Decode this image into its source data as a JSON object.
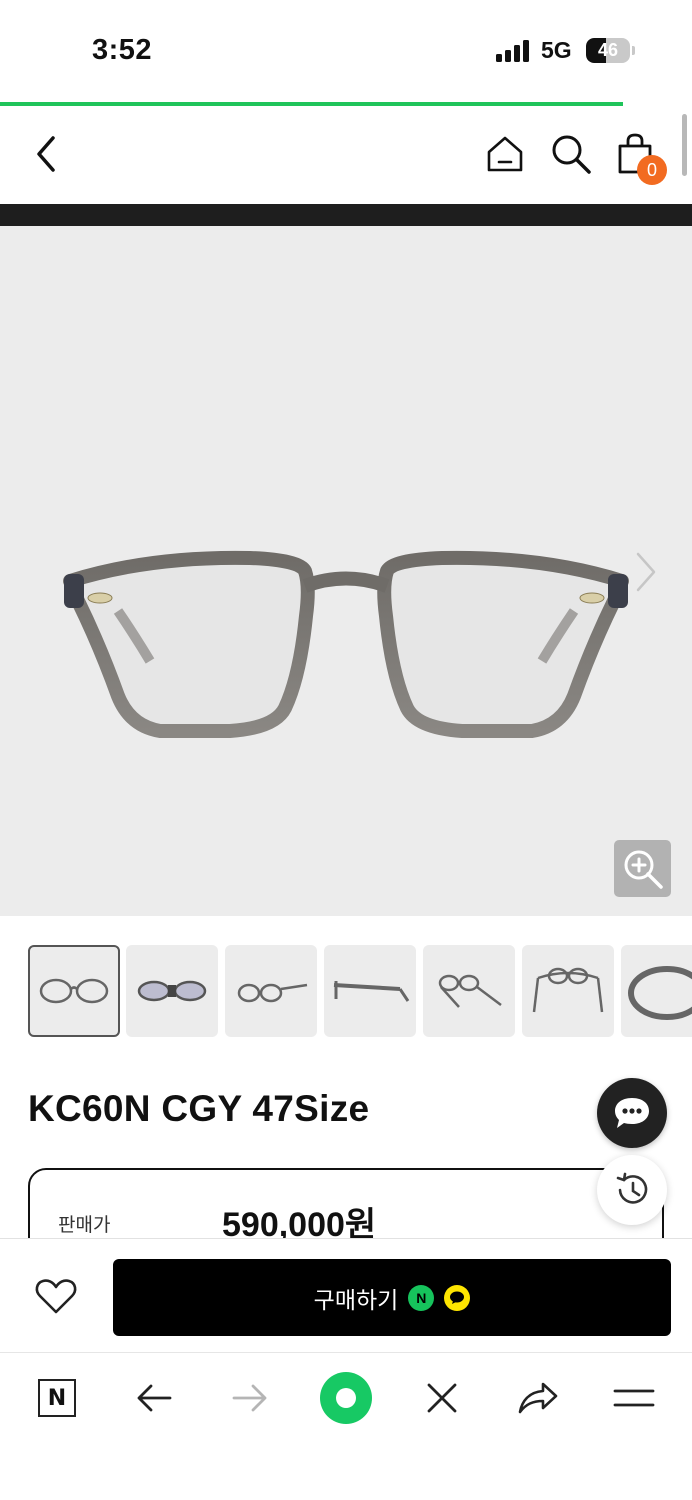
{
  "status_bar": {
    "time": "3:52",
    "network": "5G",
    "battery": "46",
    "battery_level": 0.46
  },
  "page_load_progress": 0.9,
  "header": {
    "back_icon": "chevron-left-icon",
    "home_icon": "home-icon",
    "search_icon": "search-icon",
    "cart_icon": "shopping-bag-icon",
    "cart_count": "0"
  },
  "product": {
    "image_alt": "eyeglasses-front-view",
    "title": "KC60N CGY 47Size",
    "price_label": "판매가",
    "price": "590,000원",
    "thumbnail_count": 7
  },
  "buy_bar": {
    "buy_label": "구매하기",
    "naver_pay_badge": "N",
    "wish_icon": "heart-icon"
  },
  "floating": {
    "chat_icon": "chat-bubble-icon",
    "history_icon": "history-icon"
  },
  "browser_toolbar": {
    "naver_label": "N"
  },
  "colors": {
    "accent_green": "#1fc45a",
    "badge_orange": "#f26b21",
    "buy_button": "#000000",
    "image_bg": "#ececec"
  }
}
